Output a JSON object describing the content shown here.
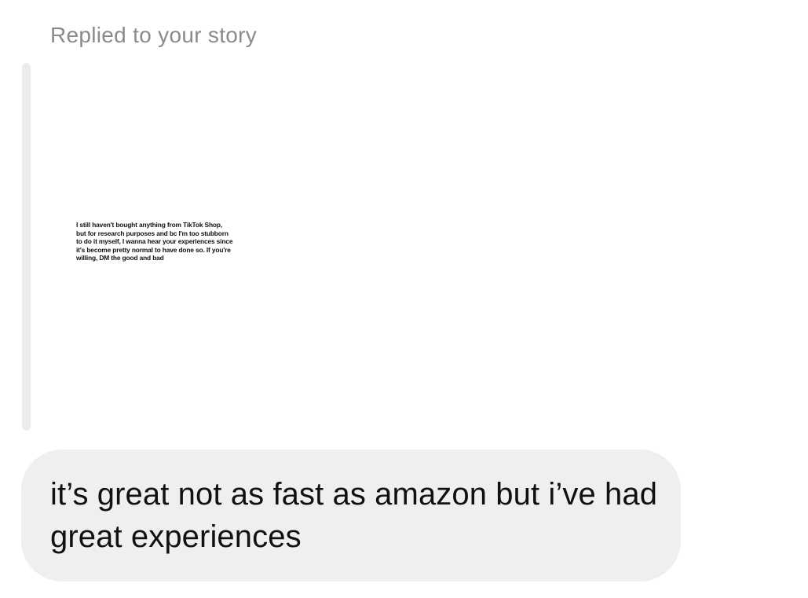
{
  "story_reply": {
    "header": "Replied to your story",
    "story_text": "I still haven't bought anything from TikTok Shop, but for research purposes and bc I'm too stubborn to do it myself, I wanna hear your experiences since it's become pretty normal to have done so. If you're willing, DM the good and bad"
  },
  "message": {
    "text": "it’s great not as fast as amazon but i’ve had great experiences"
  },
  "colors": {
    "bubble_background": "#efefef",
    "quote_bar": "#ececec",
    "header_text": "#8a8a8e",
    "message_text": "#111111"
  }
}
